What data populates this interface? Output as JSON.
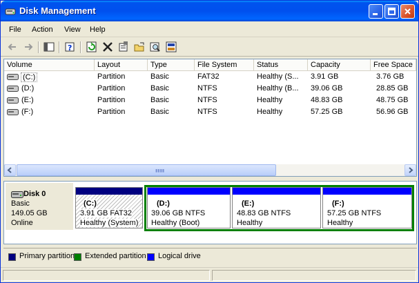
{
  "window": {
    "title": "Disk Management"
  },
  "menu": [
    "File",
    "Action",
    "View",
    "Help"
  ],
  "volume_list": {
    "columns": [
      "Volume",
      "Layout",
      "Type",
      "File System",
      "Status",
      "Capacity",
      "Free Space"
    ],
    "rows": [
      {
        "volume": "(C:)",
        "layout": "Partition",
        "type": "Basic",
        "fs": "FAT32",
        "status": "Healthy (S...",
        "capacity": "3.91 GB",
        "free": "3.76 GB"
      },
      {
        "volume": "(D:)",
        "layout": "Partition",
        "type": "Basic",
        "fs": "NTFS",
        "status": "Healthy (B...",
        "capacity": "39.06 GB",
        "free": "28.85 GB"
      },
      {
        "volume": "(E:)",
        "layout": "Partition",
        "type": "Basic",
        "fs": "NTFS",
        "status": "Healthy",
        "capacity": "48.83 GB",
        "free": "48.75 GB"
      },
      {
        "volume": "(F:)",
        "layout": "Partition",
        "type": "Basic",
        "fs": "NTFS",
        "status": "Healthy",
        "capacity": "57.25 GB",
        "free": "56.96 GB"
      }
    ]
  },
  "disk": {
    "name": "Disk 0",
    "kind": "Basic",
    "size": "149.05 GB",
    "state": "Online",
    "partitions": [
      {
        "drive": "(C:)",
        "detail": "3.91 GB FAT32",
        "status": "Healthy (System)",
        "bar_color": "#000080"
      },
      {
        "drive": "(D:)",
        "detail": "39.06 GB NTFS",
        "status": "Healthy (Boot)",
        "bar_color": "#0000ff"
      },
      {
        "drive": "(E:)",
        "detail": "48.83 GB NTFS",
        "status": "Healthy",
        "bar_color": "#0000ff"
      },
      {
        "drive": "(F:)",
        "detail": "57.25 GB NTFS",
        "status": "Healthy",
        "bar_color": "#0000ff"
      }
    ]
  },
  "legend": [
    {
      "label": "Primary partition",
      "color": "#000080"
    },
    {
      "label": "Extended partition",
      "color": "#008000"
    },
    {
      "label": "Logical drive",
      "color": "#0000ff"
    }
  ],
  "icons": {
    "title": "disk-management-icon",
    "toolbar": [
      "back-arrow-icon",
      "forward-arrow-icon",
      "show-hide-console-tree-icon",
      "help-icon",
      "refresh-icon",
      "delete-icon",
      "properties-icon",
      "open-icon",
      "explore-icon",
      "disk-view-icon"
    ]
  }
}
